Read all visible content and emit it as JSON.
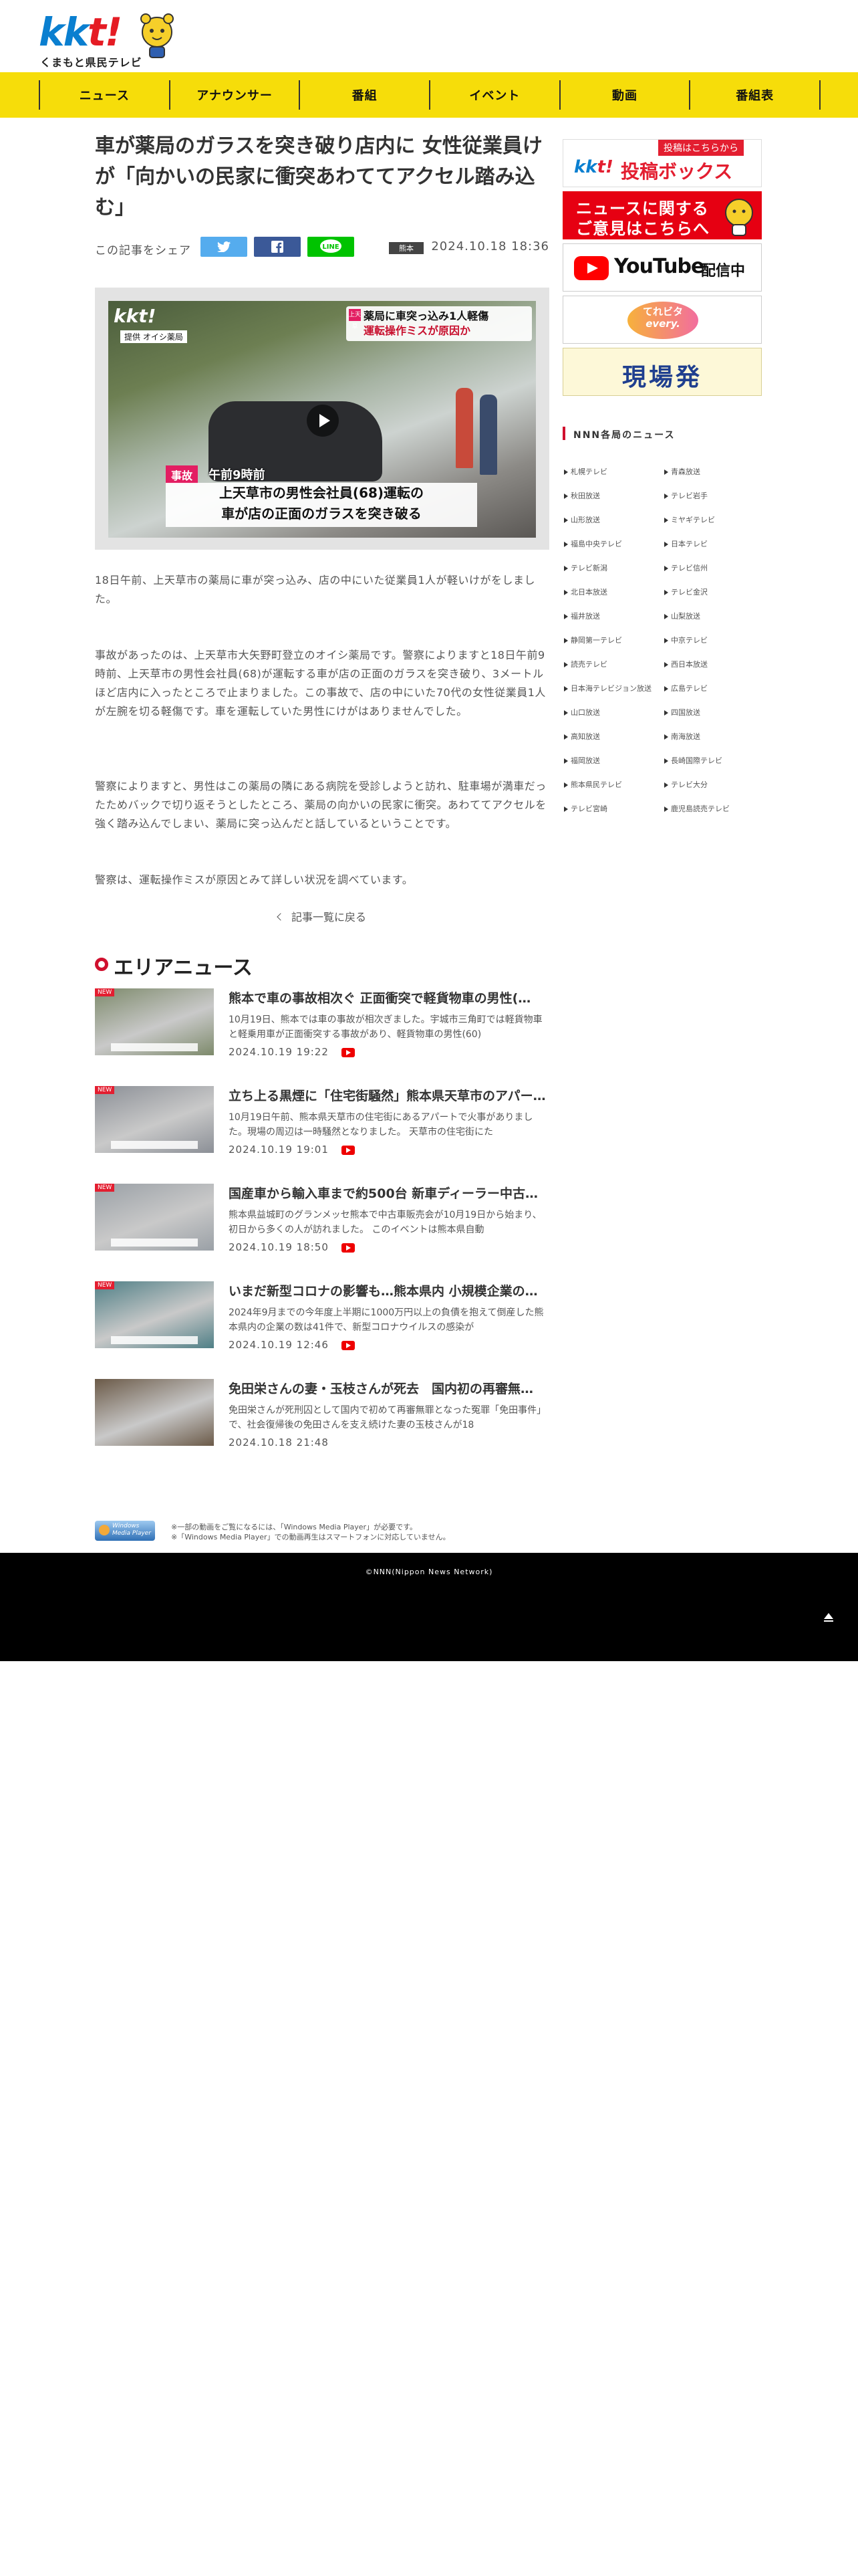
{
  "header": {
    "logo_text_k1": "kk",
    "logo_text_k2": "t",
    "logo_text_bang": "!",
    "logo_sub": "くまもと県民テレビ"
  },
  "nav": {
    "items": [
      {
        "label": "ニュース"
      },
      {
        "label": "アナウンサー"
      },
      {
        "label": "番組"
      },
      {
        "label": "イベント"
      },
      {
        "label": "動画"
      },
      {
        "label": "番組表"
      }
    ]
  },
  "article": {
    "title": "車が薬局のガラスを突き破り店内に 女性従業員けが「向かいの民家に衝突あわててアクセル踏み込む」",
    "share_label": "この記事をシェア",
    "share_twitter_icon": "twitter-icon",
    "share_facebook_icon": "facebook-icon",
    "share_line": "LINE",
    "prefecture": "熊本",
    "datetime": "2024.10.18 18:36",
    "video": {
      "logo": "kkt!",
      "source_credit": "提供 オイシ薬局",
      "tag_line1": "薬局に車突っ込み1人軽傷",
      "tag_line2": "運転操作ミスが原因か",
      "tag_box": "上天草",
      "category": "事故",
      "time": "午前9時前",
      "caption_line1": "上天草市の男性会社員(68)運転の",
      "caption_line2": "車が店の正面のガラスを突き破る"
    },
    "paragraphs": [
      "18日午前、上天草市の薬局に車が突っ込み、店の中にいた従業員1人が軽いけがをしました。",
      "事故があったのは、上天草市大矢野町登立のオイシ薬局です。警察によりますと18日午前9時前、上天草市の男性会社員(68)が運転する車が店の正面のガラスを突き破り、3メートルほど店内に入ったところで止まりました。この事故で、店の中にいた70代の女性従業員1人が左腕を切る軽傷です。車を運転していた男性にけがはありませんでした。",
      "警察によりますと、男性はこの薬局の隣にある病院を受診しようと訪れ、駐車場が満車だったためバックで切り返そうとしたところ、薬局の向かいの民家に衝突。あわててアクセルを強く踏み込んでしまい、薬局に突っ込んだと話しているということです。",
      "警察は、運転操作ミスが原因とみて詳しい状況を調べています。"
    ],
    "back_link": "記事一覧に戻る"
  },
  "area_news": {
    "title": "エリアニュース",
    "new_badge": "NEW",
    "items": [
      {
        "title": "熊本で車の事故相次ぐ 正面衝突で軽貨物車の男性(…",
        "desc": "10月19日、熊本では車の事故が相次ぎました。宇城市三角町では軽貨物車と軽乗用車が正面衝突する事故があり、軽貨物車の男性(60)",
        "date": "2024.10.19 19:22",
        "has_video": true,
        "is_new": true,
        "thumb_color": "#7d8a6b"
      },
      {
        "title": "立ち上る黒煙に「住宅街騒然」熊本県天草市のアパー…",
        "desc": "10月19日午前、熊本県天草市の住宅街にあるアパートで火事がありました。現場の周辺は一時騒然となりました。 天草市の住宅街にた",
        "date": "2024.10.19 19:01",
        "has_video": true,
        "is_new": true,
        "thumb_color": "#8b8f96"
      },
      {
        "title": "国産車から輸入車まで約500台 新車ディーラー中古…",
        "desc": "熊本県益城町のグランメッセ熊本で中古車販売会が10月19日から始まり、初日から多くの人が訪れました。 このイベントは熊本県自動",
        "date": "2024.10.19 18:50",
        "has_video": true,
        "is_new": true,
        "thumb_color": "#9aa0a6"
      },
      {
        "title": "いまだ新型コロナの影響も…熊本県内 小規模企業の…",
        "desc": "2024年9月までの今年度上半期に1000万円以上の負債を抱えて倒産した熊本県内の企業の数は41件で、新型コロナウイルスの感染が",
        "date": "2024.10.19 12:46",
        "has_video": true,
        "is_new": true,
        "thumb_color": "#4f7f86"
      },
      {
        "title": "免田栄さんの妻・玉枝さんが死去　国内初の再審無…",
        "desc": "免田栄さんが死刑囚として国内で初めて再審無罪となった冤罪「免田事件」で、社会復帰後の免田さんを支え続けた妻の玉枝さんが18",
        "date": "2024.10.18 21:48",
        "has_video": false,
        "is_new": false,
        "thumb_color": "#6b5a48"
      }
    ]
  },
  "wmp": {
    "icon_label": "Windows Media Player",
    "note1": "※一部の動画をご覧になるには、「Windows Media Player」が必要です。",
    "note2": "※「Windows Media Player」での動画再生はスマートフォンに対応していません。"
  },
  "sidebar": {
    "banner_toko_top": "投稿はこちらから",
    "banner_toko_kkt": "kkt!",
    "banner_toko_main": "投稿ボックス",
    "banner_iken_line1": "ニュースに関する",
    "banner_iken_line2": "ご意見はこちらへ",
    "banner_yt_word": "YouTube",
    "banner_yt_word2": "配信中",
    "banner_every_line1": "てれビタ",
    "banner_every_line2": "every.",
    "banner_genba": "現場発",
    "nnn_title": "NNN各局のニュース",
    "stations": [
      "札幌テレビ",
      "青森放送",
      "秋田放送",
      "テレビ岩手",
      "山形放送",
      "ミヤギテレビ",
      "福島中央テレビ",
      "日本テレビ",
      "テレビ新潟",
      "テレビ信州",
      "北日本放送",
      "テレビ金沢",
      "福井放送",
      "山梨放送",
      "静岡第一テレビ",
      "中京テレビ",
      "読売テレビ",
      "西日本放送",
      "日本海テレビジョン放送",
      "広島テレビ",
      "山口放送",
      "四国放送",
      "高知放送",
      "南海放送",
      "福岡放送",
      "長崎国際テレビ",
      "熊本県民テレビ",
      "テレビ大分",
      "テレビ宮崎",
      "鹿児島読売テレビ"
    ]
  },
  "footer": {
    "copyright": "©NNN(Nippon News Network)"
  },
  "colors": {
    "nav_yellow": "#f6dd0a",
    "accent_red": "#d0102e",
    "twitter": "#55acee",
    "facebook": "#3b5998",
    "line": "#00c300"
  }
}
